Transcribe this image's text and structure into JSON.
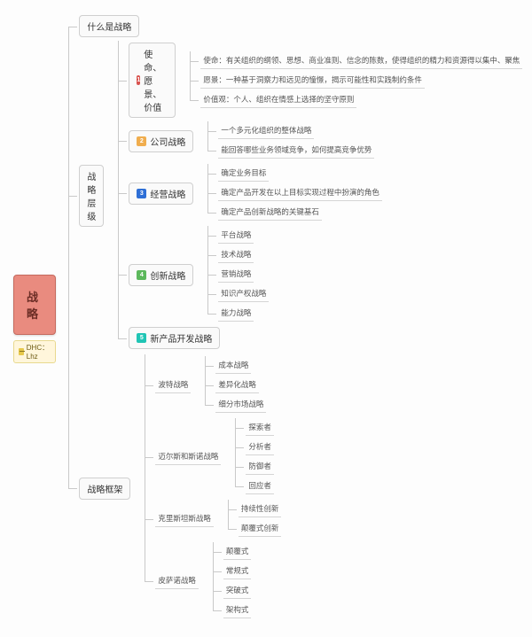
{
  "root": {
    "title": "战略",
    "tag": "DHC：Lhz"
  },
  "b1": {
    "title": "什么是战略"
  },
  "b2": {
    "title": "战略层级",
    "n1": {
      "title": "使命、愿景、价值",
      "l1": "使命：有关组织的纲领、思想、商业准则、信念的陈数，使得组织的精力和资源得以集中、聚焦",
      "l2": "愿景：一种基于洞察力和远见的憧憬，揭示可能性和实践制约条件",
      "l3": "价值观：个人、组织在情感上选择的坚守原则"
    },
    "n2": {
      "title": "公司战略",
      "l1": "一个多元化组织的整体战略",
      "l2": "能回答哪些业务领域竞争，如何提高竞争优势"
    },
    "n3": {
      "title": "经营战略",
      "l1": "确定业务目标",
      "l2": "确定产品开发在以上目标实现过程中扮演的角色",
      "l3": "确定产品创新战略的关键基石"
    },
    "n4": {
      "title": "创新战略",
      "l1": "平台战略",
      "l2": "技术战略",
      "l3": "营销战略",
      "l4": "知识产权战略",
      "l5": "能力战略"
    },
    "n5": {
      "title": "新产品开发战略"
    }
  },
  "b3": {
    "title": "战略框架",
    "n1": {
      "title": "波特战略",
      "l1": "成本战略",
      "l2": "差异化战略",
      "l3": "细分市场战略"
    },
    "n2": {
      "title": "迈尔斯和斯诺战略",
      "l1": "探索者",
      "l2": "分析者",
      "l3": "防御者",
      "l4": "回应者"
    },
    "n3": {
      "title": "克里斯坦斯战略",
      "l1": "持续性创新",
      "l2": "颠覆式创新"
    },
    "n4": {
      "title": "皮萨诺战略",
      "l1": "颠覆式",
      "l2": "常规式",
      "l3": "突破式",
      "l4": "架构式"
    }
  }
}
